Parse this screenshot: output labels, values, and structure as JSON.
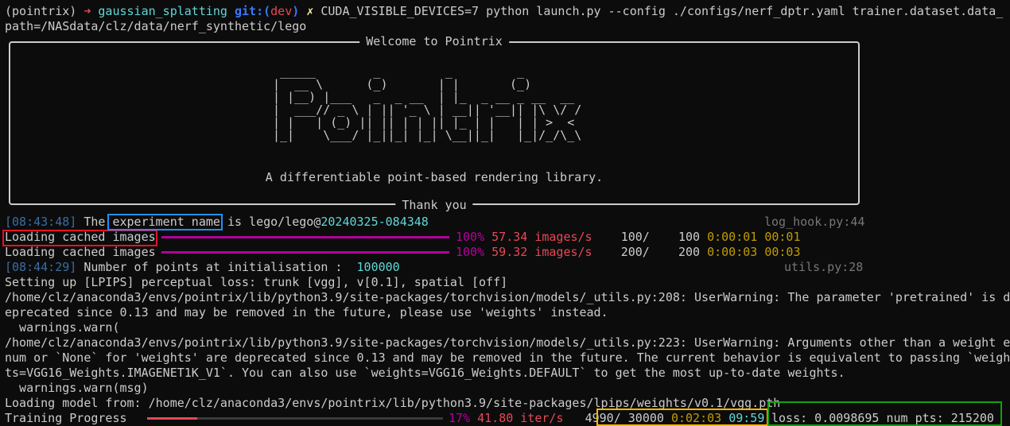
{
  "prompt": {
    "env": "(pointrix)",
    "arrow": "➜",
    "dir": "gaussian_splatting",
    "git_label": "git:(",
    "branch": "dev",
    "git_close": ")",
    "dirty_mark": "✗",
    "command_line1": "CUDA_VISIBLE_DEVICES=7 python launch.py --config ./configs/nerf_dptr.yaml trainer.dataset.data_",
    "command_line2": "path=/NASdata/clz/data/nerf_synthetic/lego"
  },
  "welcome_panel": {
    "title": "Welcome to Pointrix",
    "ascii_art": " _____        _         _         _\n|  __ \\      (_)       | |       (_)\n| |__) |___   _  _ __  | |_  _ __ _ __  __\n|  ___// _ \\ | || '_ \\ | __|| '__|| |\\ \\/ /\n| |   | (_) || || | | || |_ | |   | | >  <\n|_|    \\___/ |_||_| |_| \\__||_|   |_|/_/\\_\\",
    "tagline": "A differentiable point-based rendering library.",
    "footer": "Thank you"
  },
  "log1": {
    "time": "[08:43:48]",
    "pre": "The ",
    "highlight": "experiment name",
    "mid": " is lego/lego@",
    "stamp": "20240325-084348",
    "source": "log_hook.py:44"
  },
  "progress_rows": [
    {
      "label": "Loading cached images",
      "percent": "100%",
      "percent_value": 100,
      "rate": "57.34 images/s",
      "count": "100/",
      "total": "100",
      "elapsed": "0:00:01",
      "remaining": "00:01"
    },
    {
      "label": "Loading cached images",
      "percent": "100%",
      "percent_value": 100,
      "rate": "59.32 images/s",
      "count": "200/",
      "total": "200",
      "elapsed": "0:00:03",
      "remaining": "00:03"
    }
  ],
  "log2": {
    "time": "[08:44:29]",
    "text": "Number of points at initialisation : ",
    "value": "100000",
    "source": "utils.py:28"
  },
  "output_lines": [
    "Setting up [LPIPS] perceptual loss: trunk [vgg], v[0.1], spatial [off]",
    "/home/clz/anaconda3/envs/pointrix/lib/python3.9/site-packages/torchvision/models/_utils.py:208: UserWarning: The parameter 'pretrained' is d",
    "eprecated since 0.13 and may be removed in the future, please use 'weights' instead.",
    "  warnings.warn(",
    "/home/clz/anaconda3/envs/pointrix/lib/python3.9/site-packages/torchvision/models/_utils.py:223: UserWarning: Arguments other than a weight e",
    "num or `None` for 'weights' are deprecated since 0.13 and may be removed in the future. The current behavior is equivalent to passing `weigh",
    "ts=VGG16_Weights.IMAGENET1K_V1`. You can also use `weights=VGG16_Weights.DEFAULT` to get the most up-to-date weights.",
    "  warnings.warn(msg)",
    "Loading model from: /home/clz/anaconda3/envs/pointrix/lib/python3.9/site-packages/lpips/weights/v0.1/vgg.pth"
  ],
  "training": {
    "label": "Training Progress",
    "percent": "17%",
    "percent_value": 17,
    "rate": "41.80 iter/s",
    "count": "4990/",
    "total": "30000",
    "elapsed": "0:02:03",
    "remaining": "09:59",
    "stats": "loss: 0.0098695 num_pts: 215200"
  },
  "colors": {
    "background": "#0c0c0c",
    "highlight_red": "#e81123",
    "highlight_blue": "#1e90ff",
    "highlight_orange": "#ffb900",
    "highlight_green": "#13a10e",
    "progress_complete": "#b4009e",
    "progress_partial": "#e74856"
  }
}
